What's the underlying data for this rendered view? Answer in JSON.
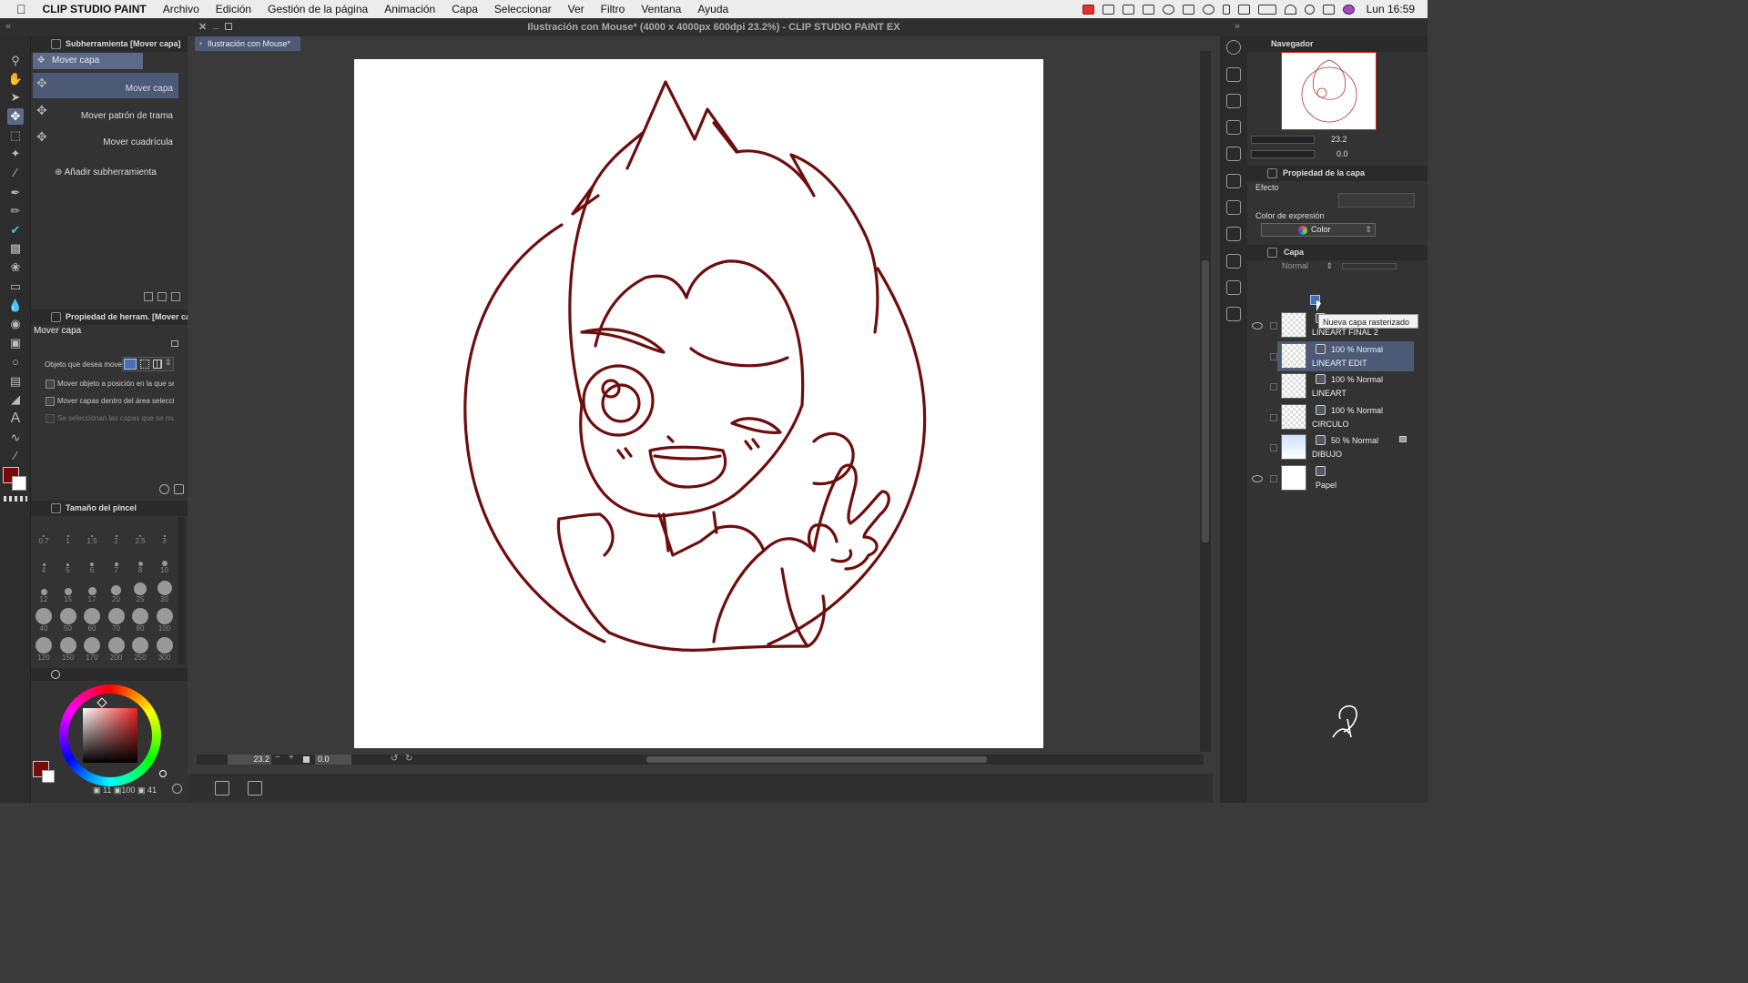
{
  "menubar": {
    "app": "CLIP STUDIO PAINT",
    "items": [
      "Archivo",
      "Edición",
      "Gestión de la página",
      "Animación",
      "Capa",
      "Seleccionar",
      "Ver",
      "Filtro",
      "Ventana",
      "Ayuda"
    ],
    "clock": "Lun 16:59"
  },
  "window": {
    "title": "Ilustración con Mouse* (4000 x 4000px 600dpi 23.2%)  - CLIP STUDIO PAINT EX",
    "doc_tab": "Ilustración con Mouse*"
  },
  "subtool_panel": {
    "header": "Subherramienta [Mover capa]",
    "group_tab": "Mover capa",
    "items": [
      {
        "label": "Mover capa",
        "selected": true
      },
      {
        "label": "Mover patrón de trama",
        "selected": false
      },
      {
        "label": "Mover cuadrícula",
        "selected": false
      }
    ],
    "add_label": "Añadir subherramienta"
  },
  "tool_property": {
    "header": "Propiedad de herram. [Mover capa]",
    "tool_name": "Mover capa",
    "object_label": "Objeto que desea mover",
    "options": [
      {
        "label": "Mover objeto a posición en la que se ha",
        "checked": false
      },
      {
        "label": "Mover capas dentro del área seleccionada",
        "checked": false
      },
      {
        "label": "Se seleccionan las capas que se mueven",
        "checked": false,
        "disabled": true
      }
    ]
  },
  "brush_size": {
    "header": "Tamaño del pincel",
    "sizes": [
      "0.7",
      "1",
      "1.5",
      "2",
      "2.5",
      "3",
      "4",
      "5",
      "6",
      "7",
      "8",
      "10",
      "12",
      "15",
      "17",
      "20",
      "25",
      "30",
      "40",
      "50",
      "60",
      "70",
      "80",
      "100",
      "120",
      "150",
      "170",
      "200",
      "250",
      "300"
    ]
  },
  "color_panel": {
    "main_color": "#7a0a0a",
    "sub_color": "#ffffff",
    "readout": [
      "11",
      "100",
      "41"
    ]
  },
  "canvas": {
    "zoom": "23.2",
    "rotation": "0.0",
    "line_color": "#6e0d0d"
  },
  "navigator": {
    "title": "Navegador",
    "zoom": "23.2",
    "angle": "0.0"
  },
  "layer_property": {
    "title": "Propiedad de la capa",
    "effect_label": "Efecto",
    "expression_label": "Color de expresión",
    "expression_value": "Color"
  },
  "layers_panel": {
    "title": "Capa",
    "blend_mode": "Normal",
    "tooltip": "Nueva capa rasterizado",
    "layers": [
      {
        "name": "LINEART FINAL 2",
        "mode": "",
        "visible": true,
        "selected": false,
        "thumb": "checker"
      },
      {
        "name": "LINEART EDIT",
        "mode": "100 % Normal",
        "visible": false,
        "selected": true,
        "thumb": "checker"
      },
      {
        "name": "LINEART",
        "mode": "100 % Normal",
        "visible": false,
        "selected": false,
        "thumb": "checker"
      },
      {
        "name": "CIRCULO",
        "mode": "100 % Normal",
        "visible": false,
        "selected": false,
        "thumb": "checker"
      },
      {
        "name": "DIBUJO",
        "mode": "50 % Normal",
        "visible": false,
        "selected": false,
        "thumb": "sketch",
        "locked": true
      },
      {
        "name": "Papel",
        "mode": "",
        "visible": true,
        "selected": false,
        "thumb": "white"
      }
    ]
  },
  "signature": {
    "text": "Kevin Farias"
  }
}
